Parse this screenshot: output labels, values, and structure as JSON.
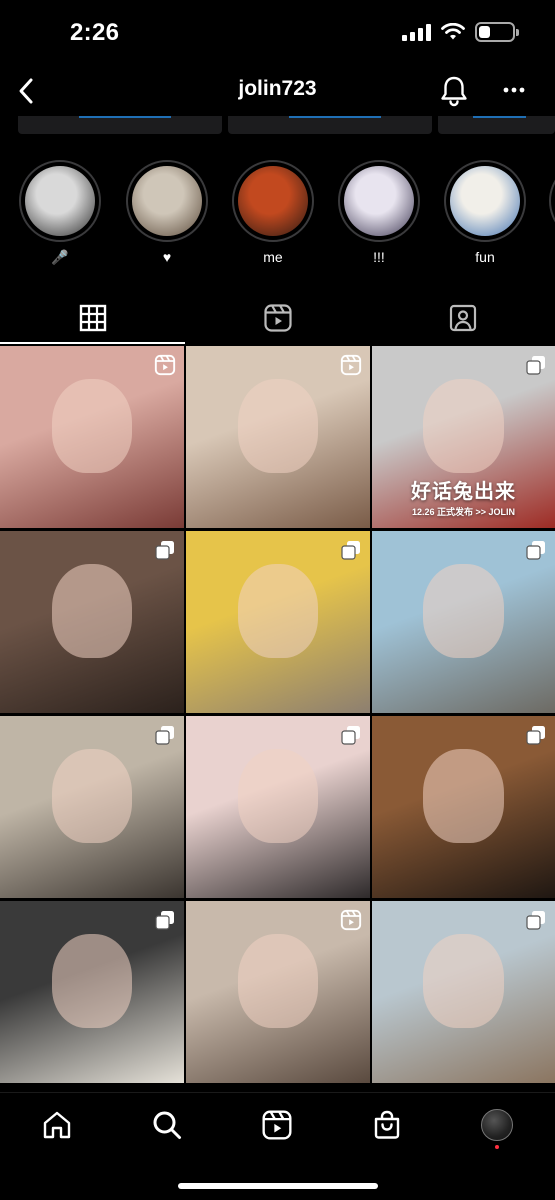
{
  "status_bar": {
    "time": "2:26",
    "battery_level": 0.35
  },
  "header": {
    "username": "jolin723",
    "icons": [
      "back-icon",
      "bell-icon",
      "more-icon"
    ]
  },
  "highlights": [
    {
      "label": "🎤",
      "colors": [
        "#d9d9d9",
        "#2b2b2b"
      ]
    },
    {
      "label": "♥",
      "colors": [
        "#cfc6b8",
        "#5b4a3a"
      ]
    },
    {
      "label": "me",
      "colors": [
        "#c2491f",
        "#2a1a14"
      ]
    },
    {
      "label": "!!!",
      "colors": [
        "#e8e4ef",
        "#3b3550"
      ]
    },
    {
      "label": "fun",
      "colors": [
        "#f1efe9",
        "#3d6fb0"
      ]
    }
  ],
  "tabs": [
    {
      "name": "posts",
      "icon": "grid-icon",
      "active": true
    },
    {
      "name": "reels",
      "icon": "reels-icon",
      "active": false
    },
    {
      "name": "tagged",
      "icon": "tagged-icon",
      "active": false
    }
  ],
  "posts": [
    {
      "badge": "reel",
      "colors": [
        "#d9a9a0",
        "#7a3b36"
      ],
      "caption": "",
      "caption_sub": ""
    },
    {
      "badge": "reel",
      "colors": [
        "#d8c7b6",
        "#7a5c48"
      ],
      "caption": "",
      "caption_sub": ""
    },
    {
      "badge": "multi",
      "colors": [
        "#c9c9c9",
        "#9e2b24"
      ],
      "caption": "好话兔出来",
      "caption_sub": "12.26 正式发布 >> JOLIN"
    },
    {
      "badge": "multi",
      "colors": [
        "#6b5346",
        "#2b211c"
      ],
      "caption": "",
      "caption_sub": ""
    },
    {
      "badge": "multi",
      "colors": [
        "#e6c44a",
        "#8d7f70"
      ],
      "caption": "",
      "caption_sub": ""
    },
    {
      "badge": "multi",
      "colors": [
        "#9fc2d6",
        "#6d6a63"
      ],
      "caption": "",
      "caption_sub": ""
    },
    {
      "badge": "multi",
      "colors": [
        "#bfb5a6",
        "#3b3530"
      ],
      "caption": "",
      "caption_sub": ""
    },
    {
      "badge": "multi",
      "colors": [
        "#e9d2cf",
        "#2e2a2b"
      ],
      "caption": "",
      "caption_sub": ""
    },
    {
      "badge": "multi",
      "colors": [
        "#8a5a36",
        "#1f1712"
      ],
      "caption": "",
      "caption_sub": ""
    },
    {
      "badge": "multi",
      "colors": [
        "#3a3a3a",
        "#e5e1d8"
      ],
      "caption": "",
      "caption_sub": ""
    },
    {
      "badge": "reel",
      "colors": [
        "#c8b9ab",
        "#5a4a3f"
      ],
      "caption": "",
      "caption_sub": ""
    },
    {
      "badge": "multi",
      "colors": [
        "#b9c7cf",
        "#8b7560"
      ],
      "caption": "",
      "caption_sub": ""
    }
  ],
  "bottom_nav": [
    {
      "name": "home",
      "icon": "home-icon"
    },
    {
      "name": "search",
      "icon": "search-icon"
    },
    {
      "name": "reels",
      "icon": "reels-icon"
    },
    {
      "name": "shop",
      "icon": "shop-icon"
    },
    {
      "name": "profile",
      "icon": "avatar"
    }
  ]
}
